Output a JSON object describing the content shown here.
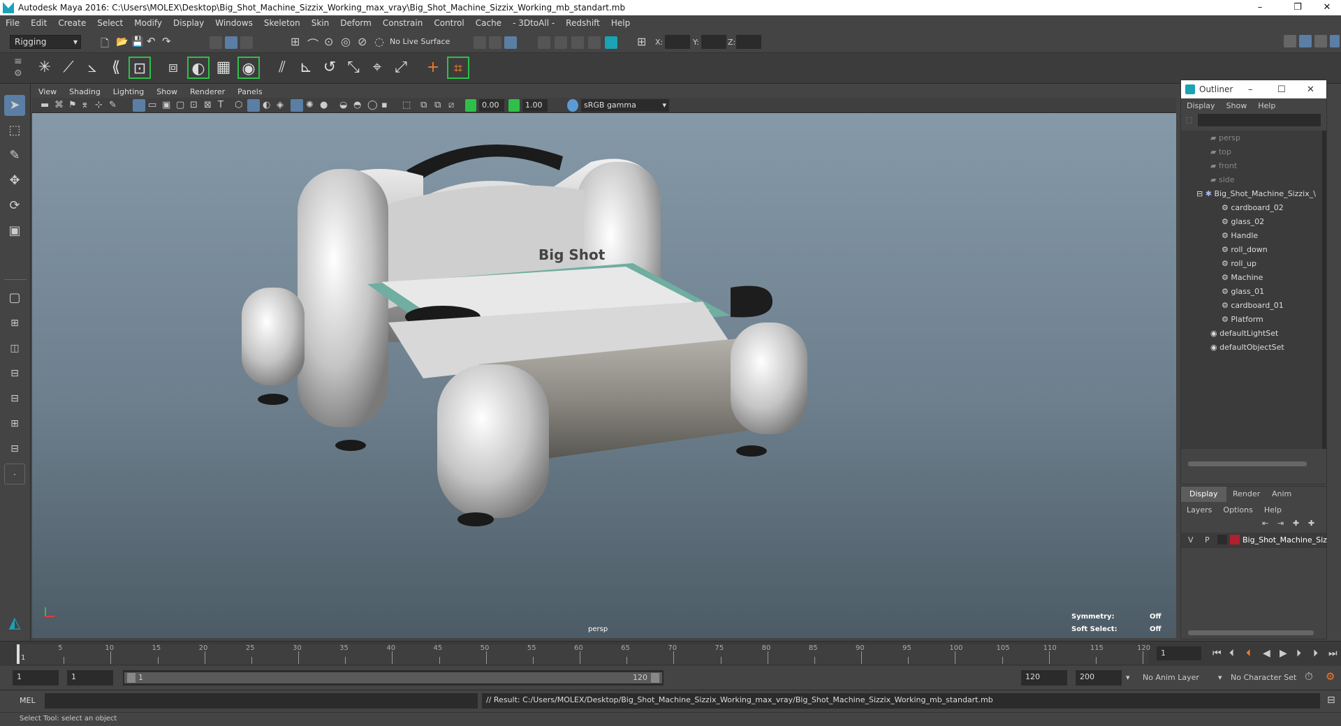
{
  "window": {
    "title": "Autodesk Maya 2016: C:\\Users\\MOLEX\\Desktop\\Big_Shot_Machine_Sizzix_Working_max_vray\\Big_Shot_Machine_Sizzix_Working_mb_standart.mb",
    "minimize": "–",
    "restore": "❐",
    "close": "✕"
  },
  "menubar": {
    "items": [
      "File",
      "Edit",
      "Create",
      "Select",
      "Modify",
      "Display",
      "Windows",
      "Skeleton",
      "Skin",
      "Deform",
      "Constrain",
      "Control",
      "Cache",
      "- 3DtoAll -",
      "Redshift",
      "Help"
    ]
  },
  "statusline": {
    "menuset": "Rigging",
    "live_surface": "No Live Surface",
    "x_label": "X:",
    "y_label": "Y:",
    "z_label": "Z:"
  },
  "viewport": {
    "menu": [
      "View",
      "Shading",
      "Lighting",
      "Show",
      "Renderer",
      "Panels"
    ],
    "exposure": "0.00",
    "gamma": "1.00",
    "colorspace": "sRGB gamma",
    "camera": "persp",
    "symmetry_label": "Symmetry:",
    "symmetry_value": "Off",
    "softselect_label": "Soft Select:",
    "softselect_value": "Off",
    "model_brand": "Big Shot"
  },
  "outliner": {
    "title": "Outliner",
    "menu": [
      "Display",
      "Show",
      "Help"
    ],
    "items": [
      {
        "label": "persp",
        "depth": 1,
        "dim": true,
        "icon": "camera-icon"
      },
      {
        "label": "top",
        "depth": 1,
        "dim": true,
        "icon": "camera-icon"
      },
      {
        "label": "front",
        "depth": 1,
        "dim": true,
        "icon": "camera-icon"
      },
      {
        "label": "side",
        "depth": 1,
        "dim": true,
        "icon": "camera-icon"
      },
      {
        "label": "Big_Shot_Machine_Sizzix_\\",
        "depth": 0,
        "dim": false,
        "icon": "group-icon"
      },
      {
        "label": "cardboard_02",
        "depth": 2,
        "dim": false,
        "icon": "mesh-icon"
      },
      {
        "label": "glass_02",
        "depth": 2,
        "dim": false,
        "icon": "mesh-icon"
      },
      {
        "label": "Handle",
        "depth": 2,
        "dim": false,
        "icon": "mesh-icon"
      },
      {
        "label": "roll_down",
        "depth": 2,
        "dim": false,
        "icon": "mesh-icon"
      },
      {
        "label": "roll_up",
        "depth": 2,
        "dim": false,
        "icon": "mesh-icon"
      },
      {
        "label": "Machine",
        "depth": 2,
        "dim": false,
        "icon": "mesh-icon"
      },
      {
        "label": "glass_01",
        "depth": 2,
        "dim": false,
        "icon": "mesh-icon"
      },
      {
        "label": "cardboard_01",
        "depth": 2,
        "dim": false,
        "icon": "mesh-icon"
      },
      {
        "label": "Platform",
        "depth": 2,
        "dim": false,
        "icon": "mesh-icon"
      },
      {
        "label": "defaultLightSet",
        "depth": 1,
        "dim": false,
        "icon": "set-icon"
      },
      {
        "label": "defaultObjectSet",
        "depth": 1,
        "dim": false,
        "icon": "set-icon"
      }
    ]
  },
  "layers": {
    "tabs": [
      "Display",
      "Render",
      "Anim"
    ],
    "menu": [
      "Layers",
      "Options",
      "Help"
    ],
    "row": {
      "v": "V",
      "p": "P",
      "name": "Big_Shot_Machine_Siz",
      "color": "#b0202e"
    }
  },
  "timeline": {
    "ticks": [
      "5",
      "10",
      "15",
      "20",
      "25",
      "30",
      "35",
      "40",
      "45",
      "50",
      "55",
      "60",
      "65",
      "70",
      "75",
      "80",
      "85",
      "90",
      "95",
      "100",
      "105",
      "110",
      "115",
      "120"
    ],
    "current_frame": "1",
    "start_marker": "1"
  },
  "range": {
    "start": "1",
    "anim_start": "1",
    "range_start_label": "1",
    "range_end_label": "120",
    "end": "120",
    "anim_end": "200",
    "anim_layer": "No Anim Layer",
    "character_set": "No Character Set"
  },
  "command": {
    "mode": "MEL",
    "result": "// Result: C:/Users/MOLEX/Desktop/Big_Shot_Machine_Sizzix_Working_max_vray/Big_Shot_Machine_Sizzix_Working_mb_standart.mb"
  },
  "help": {
    "text": "Select Tool: select an object"
  },
  "colors": {
    "accent": "#5b9bd5",
    "maya_teal": "#1aa3b5",
    "highlight_green": "#2fbf4a"
  }
}
